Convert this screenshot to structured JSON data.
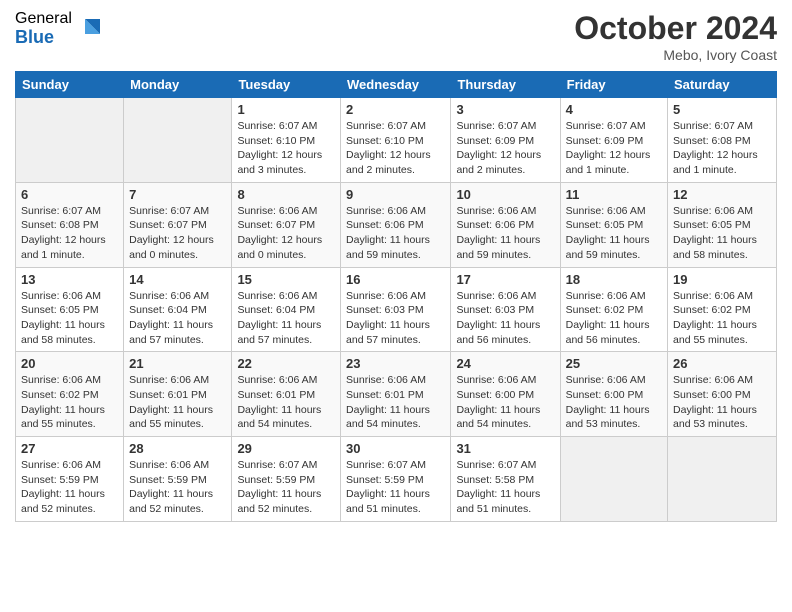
{
  "logo": {
    "general": "General",
    "blue": "Blue"
  },
  "title": {
    "month": "October 2024",
    "location": "Mebo, Ivory Coast"
  },
  "days_of_week": [
    "Sunday",
    "Monday",
    "Tuesday",
    "Wednesday",
    "Thursday",
    "Friday",
    "Saturday"
  ],
  "weeks": [
    [
      {
        "day": "",
        "info": ""
      },
      {
        "day": "",
        "info": ""
      },
      {
        "day": "1",
        "info": "Sunrise: 6:07 AM\nSunset: 6:10 PM\nDaylight: 12 hours and 3 minutes."
      },
      {
        "day": "2",
        "info": "Sunrise: 6:07 AM\nSunset: 6:10 PM\nDaylight: 12 hours and 2 minutes."
      },
      {
        "day": "3",
        "info": "Sunrise: 6:07 AM\nSunset: 6:09 PM\nDaylight: 12 hours and 2 minutes."
      },
      {
        "day": "4",
        "info": "Sunrise: 6:07 AM\nSunset: 6:09 PM\nDaylight: 12 hours and 1 minute."
      },
      {
        "day": "5",
        "info": "Sunrise: 6:07 AM\nSunset: 6:08 PM\nDaylight: 12 hours and 1 minute."
      }
    ],
    [
      {
        "day": "6",
        "info": "Sunrise: 6:07 AM\nSunset: 6:08 PM\nDaylight: 12 hours and 1 minute."
      },
      {
        "day": "7",
        "info": "Sunrise: 6:07 AM\nSunset: 6:07 PM\nDaylight: 12 hours and 0 minutes."
      },
      {
        "day": "8",
        "info": "Sunrise: 6:06 AM\nSunset: 6:07 PM\nDaylight: 12 hours and 0 minutes."
      },
      {
        "day": "9",
        "info": "Sunrise: 6:06 AM\nSunset: 6:06 PM\nDaylight: 11 hours and 59 minutes."
      },
      {
        "day": "10",
        "info": "Sunrise: 6:06 AM\nSunset: 6:06 PM\nDaylight: 11 hours and 59 minutes."
      },
      {
        "day": "11",
        "info": "Sunrise: 6:06 AM\nSunset: 6:05 PM\nDaylight: 11 hours and 59 minutes."
      },
      {
        "day": "12",
        "info": "Sunrise: 6:06 AM\nSunset: 6:05 PM\nDaylight: 11 hours and 58 minutes."
      }
    ],
    [
      {
        "day": "13",
        "info": "Sunrise: 6:06 AM\nSunset: 6:05 PM\nDaylight: 11 hours and 58 minutes."
      },
      {
        "day": "14",
        "info": "Sunrise: 6:06 AM\nSunset: 6:04 PM\nDaylight: 11 hours and 57 minutes."
      },
      {
        "day": "15",
        "info": "Sunrise: 6:06 AM\nSunset: 6:04 PM\nDaylight: 11 hours and 57 minutes."
      },
      {
        "day": "16",
        "info": "Sunrise: 6:06 AM\nSunset: 6:03 PM\nDaylight: 11 hours and 57 minutes."
      },
      {
        "day": "17",
        "info": "Sunrise: 6:06 AM\nSunset: 6:03 PM\nDaylight: 11 hours and 56 minutes."
      },
      {
        "day": "18",
        "info": "Sunrise: 6:06 AM\nSunset: 6:02 PM\nDaylight: 11 hours and 56 minutes."
      },
      {
        "day": "19",
        "info": "Sunrise: 6:06 AM\nSunset: 6:02 PM\nDaylight: 11 hours and 55 minutes."
      }
    ],
    [
      {
        "day": "20",
        "info": "Sunrise: 6:06 AM\nSunset: 6:02 PM\nDaylight: 11 hours and 55 minutes."
      },
      {
        "day": "21",
        "info": "Sunrise: 6:06 AM\nSunset: 6:01 PM\nDaylight: 11 hours and 55 minutes."
      },
      {
        "day": "22",
        "info": "Sunrise: 6:06 AM\nSunset: 6:01 PM\nDaylight: 11 hours and 54 minutes."
      },
      {
        "day": "23",
        "info": "Sunrise: 6:06 AM\nSunset: 6:01 PM\nDaylight: 11 hours and 54 minutes."
      },
      {
        "day": "24",
        "info": "Sunrise: 6:06 AM\nSunset: 6:00 PM\nDaylight: 11 hours and 54 minutes."
      },
      {
        "day": "25",
        "info": "Sunrise: 6:06 AM\nSunset: 6:00 PM\nDaylight: 11 hours and 53 minutes."
      },
      {
        "day": "26",
        "info": "Sunrise: 6:06 AM\nSunset: 6:00 PM\nDaylight: 11 hours and 53 minutes."
      }
    ],
    [
      {
        "day": "27",
        "info": "Sunrise: 6:06 AM\nSunset: 5:59 PM\nDaylight: 11 hours and 52 minutes."
      },
      {
        "day": "28",
        "info": "Sunrise: 6:06 AM\nSunset: 5:59 PM\nDaylight: 11 hours and 52 minutes."
      },
      {
        "day": "29",
        "info": "Sunrise: 6:07 AM\nSunset: 5:59 PM\nDaylight: 11 hours and 52 minutes."
      },
      {
        "day": "30",
        "info": "Sunrise: 6:07 AM\nSunset: 5:59 PM\nDaylight: 11 hours and 51 minutes."
      },
      {
        "day": "31",
        "info": "Sunrise: 6:07 AM\nSunset: 5:58 PM\nDaylight: 11 hours and 51 minutes."
      },
      {
        "day": "",
        "info": ""
      },
      {
        "day": "",
        "info": ""
      }
    ]
  ]
}
